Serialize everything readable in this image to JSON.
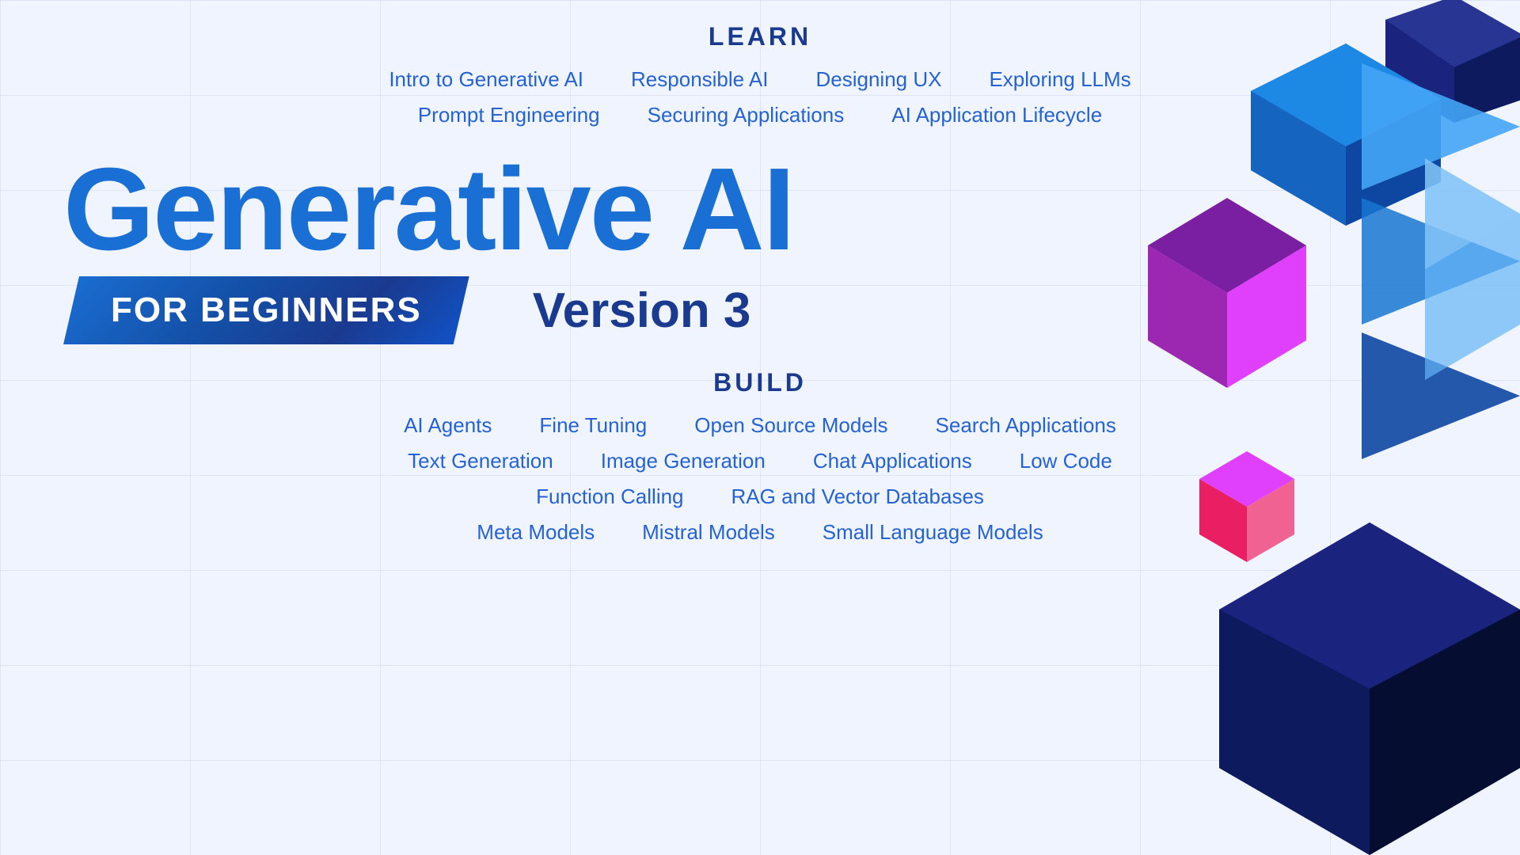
{
  "learn": {
    "label": "LEARN",
    "row1": [
      "Intro to Generative AI",
      "Responsible AI",
      "Designing UX",
      "Exploring LLMs"
    ],
    "row2": [
      "Prompt Engineering",
      "Securing Applications",
      "AI Application Lifecycle"
    ]
  },
  "hero": {
    "title": "Generative AI",
    "badge": "FOR BEGINNERS",
    "version": "Version 3"
  },
  "build": {
    "label": "BUILD",
    "row1": [
      "AI Agents",
      "Fine Tuning",
      "Open Source Models",
      "Search Applications"
    ],
    "row2": [
      "Text Generation",
      "Image Generation",
      "Chat Applications",
      "Low Code"
    ],
    "row3": [
      "Function Calling",
      "RAG and Vector Databases"
    ],
    "row4": [
      "Meta Models",
      "Mistral Models",
      "Small Language Models"
    ]
  }
}
